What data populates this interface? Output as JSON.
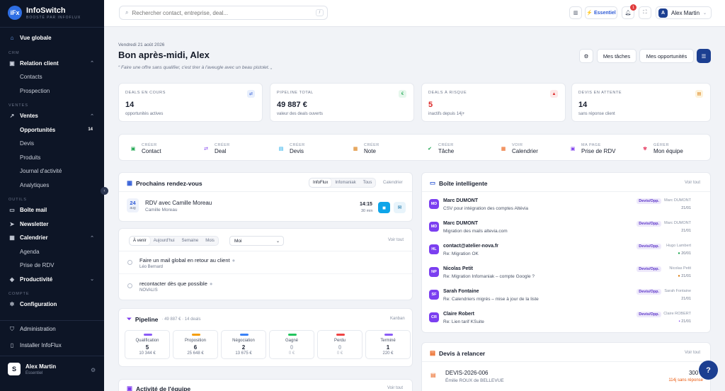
{
  "app": {
    "name": "InfoSwitch",
    "tagline": "BOOSTÉ PAR INFOFLUX",
    "logo_text": "iFx"
  },
  "sidebar": {
    "overview": "Vue globale",
    "crm_label": "CRM",
    "relation_client": "Relation client",
    "contacts": "Contacts",
    "prospection": "Prospection",
    "ventes_label": "VENTES",
    "ventes": "Ventes",
    "opportunites": "Opportunités",
    "opportunites_count": "14",
    "devis": "Devis",
    "produits": "Produits",
    "journal": "Journal d'activité",
    "analytiques": "Analytiques",
    "outils_label": "OUTILS",
    "boite_mail": "Boîte mail",
    "newsletter": "Newsletter",
    "calendrier": "Calendrier",
    "agenda": "Agenda",
    "prise_rdv": "Prise de RDV",
    "productivite": "Productivité",
    "compte_label": "COMPTE",
    "configuration": "Configuration",
    "administration": "Administration",
    "installer": "Installer InfoFlux",
    "user_name": "Alex Martin",
    "user_plan": "Essentiel",
    "user_initial": "S"
  },
  "topbar": {
    "search_placeholder": "Rechercher contact, entreprise, deal...",
    "search_shortcut": "/",
    "plan_label": "Essentiel",
    "notif_count": "1",
    "user_initial": "A",
    "user_name": "Alex Martin"
  },
  "header": {
    "date": "Vendredi 21 août 2026",
    "greeting": "Bon après-midi, Alex",
    "quote": "Faire une offre sans qualifier, c'est tirer à l'aveugle avec un beau pistolet.",
    "btn_tasks": "Mes tâches",
    "btn_opps": "Mes opportunités"
  },
  "stats": [
    {
      "label": "DEALS EN COURS",
      "value": "14",
      "sub": "opportunités actives"
    },
    {
      "label": "PIPELINE TOTAL",
      "value": "49 887 €",
      "sub": "valeur des deals ouverts"
    },
    {
      "label": "DEALS À RISQUE",
      "value": "5",
      "sub": "inactifs depuis 14j+"
    },
    {
      "label": "DEVIS EN ATTENTE",
      "value": "14",
      "sub": "sans réponse client"
    }
  ],
  "quick_actions": [
    {
      "top": "CRÉER",
      "bottom": "Contact"
    },
    {
      "top": "CRÉER",
      "bottom": "Deal"
    },
    {
      "top": "CRÉER",
      "bottom": "Devis"
    },
    {
      "top": "CRÉER",
      "bottom": "Note"
    },
    {
      "top": "CRÉER",
      "bottom": "Tâche"
    },
    {
      "top": "VOIR",
      "bottom": "Calendrier"
    },
    {
      "top": "MA PAGE",
      "bottom": "Prise de RDV"
    },
    {
      "top": "GÉRER",
      "bottom": "Mon équipe"
    }
  ],
  "rdv": {
    "title": "Prochains rendez-vous",
    "tabs": [
      "InfoFlux",
      "Infomaniak",
      "Tous"
    ],
    "link": "Calendrier",
    "day": "24",
    "month": "aug",
    "item_title": "RDV avec Camille Moreau",
    "item_sub": "Camille Moreau",
    "time": "14:15",
    "duration": "30 min"
  },
  "tasks": {
    "tabs": [
      "À venir",
      "Aujourd'hui",
      "Semaine",
      "Mois"
    ],
    "select_value": "Moi",
    "link": "Voir tout",
    "items": [
      {
        "title": "Faire un mail global en retour au client",
        "sub": "Léo Bernard"
      },
      {
        "title": "recontacter dès que possible",
        "sub": "NOVALIS"
      }
    ]
  },
  "pipeline": {
    "title": "Pipeline",
    "summary": "· 49 887 € · 14 deals",
    "link": "Kanban",
    "stages": [
      {
        "name": "Qualification",
        "count": "5",
        "amount": "10 344 €",
        "color": "#8b5cf6"
      },
      {
        "name": "Proposition",
        "count": "6",
        "amount": "25 648 €",
        "color": "#f59e0b"
      },
      {
        "name": "Négociation",
        "count": "2",
        "amount": "13 675 €",
        "color": "#3b82f6"
      },
      {
        "name": "Gagné",
        "count": "0",
        "amount": "0 €",
        "color": "#22c55e"
      },
      {
        "name": "Perdu",
        "count": "0",
        "amount": "0 €",
        "color": "#ef4444"
      },
      {
        "name": "Terminé",
        "count": "1",
        "amount": "220 €",
        "color": "#8b5cf6"
      }
    ]
  },
  "team": {
    "title": "Activité de l'équipe",
    "link": "Voir tout"
  },
  "inbox": {
    "title": "Boîte intelligente",
    "link": "Voir tout",
    "items": [
      {
        "initials": "MD",
        "from": "Marc DUMONT",
        "subject": "CSV pour intégration des comptes Altévia",
        "tag": "Devis/Opp.",
        "who": "Marc DUMONT",
        "date": "21/01"
      },
      {
        "initials": "MD",
        "from": "Marc DUMONT",
        "subject": "Migration des mails altevia.com",
        "tag": "Devis/Opp.",
        "who": "Marc DUMONT",
        "date": "21/01"
      },
      {
        "initials": "HL",
        "from": "contact@atelier-nova.fr",
        "subject": "Re: Migration OK",
        "tag": "Devis/Opp.",
        "who": "Hugo Lambert",
        "date": "20/01"
      },
      {
        "initials": "NP",
        "from": "Nicolas Petit",
        "subject": "Re: Migration Infomaniak – compte Google ?",
        "tag": "Devis/Opp.",
        "who": "Nicolas Petit",
        "date": "21/01"
      },
      {
        "initials": "SF",
        "from": "Sarah Fontaine",
        "subject": "Re: Calendriers migrés – mise à jour de la liste",
        "tag": "Devis/Opp.",
        "who": "Sarah Fontaine",
        "date": "21/01"
      },
      {
        "initials": "CR",
        "from": "Claire Robert",
        "subject": "Re: Lien tarif KSuite",
        "tag": "Devis/Opp.",
        "who": "Claire ROBERT",
        "date": "21/01"
      }
    ]
  },
  "devis": {
    "title": "Devis à relancer",
    "link": "Voir tout",
    "ref": "DEVIS-2026-006",
    "client": "Émilie ROUX de BELLEVUE",
    "amount": "300 €",
    "delay": "114j sans réponse"
  },
  "help": "?"
}
